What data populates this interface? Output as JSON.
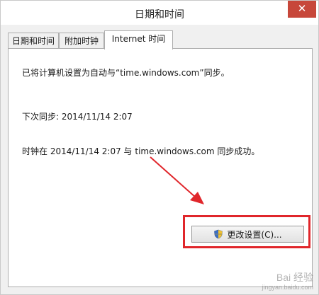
{
  "window": {
    "title": "日期和时间",
    "close_glyph": "✕",
    "close_color": "#c7473a"
  },
  "tabs": [
    {
      "label": "日期和时间",
      "active": false
    },
    {
      "label": "附加时钟",
      "active": false
    },
    {
      "label": "Internet 时间",
      "active": true
    }
  ],
  "panel": {
    "sync_config": "已将计算机设置为自动与“time.windows.com”同步。",
    "next_sync": "下次同步: 2014/11/14 2:07",
    "last_sync": "时钟在 2014/11/14 2:07 与 time.windows.com 同步成功。",
    "change_button": "更改设置(C)...",
    "change_button_icon": "uac-shield-icon"
  },
  "annotation": {
    "color": "#e0262b"
  },
  "watermark": {
    "brand": "Bai 经验",
    "url": "jingyan.baidu.com"
  }
}
